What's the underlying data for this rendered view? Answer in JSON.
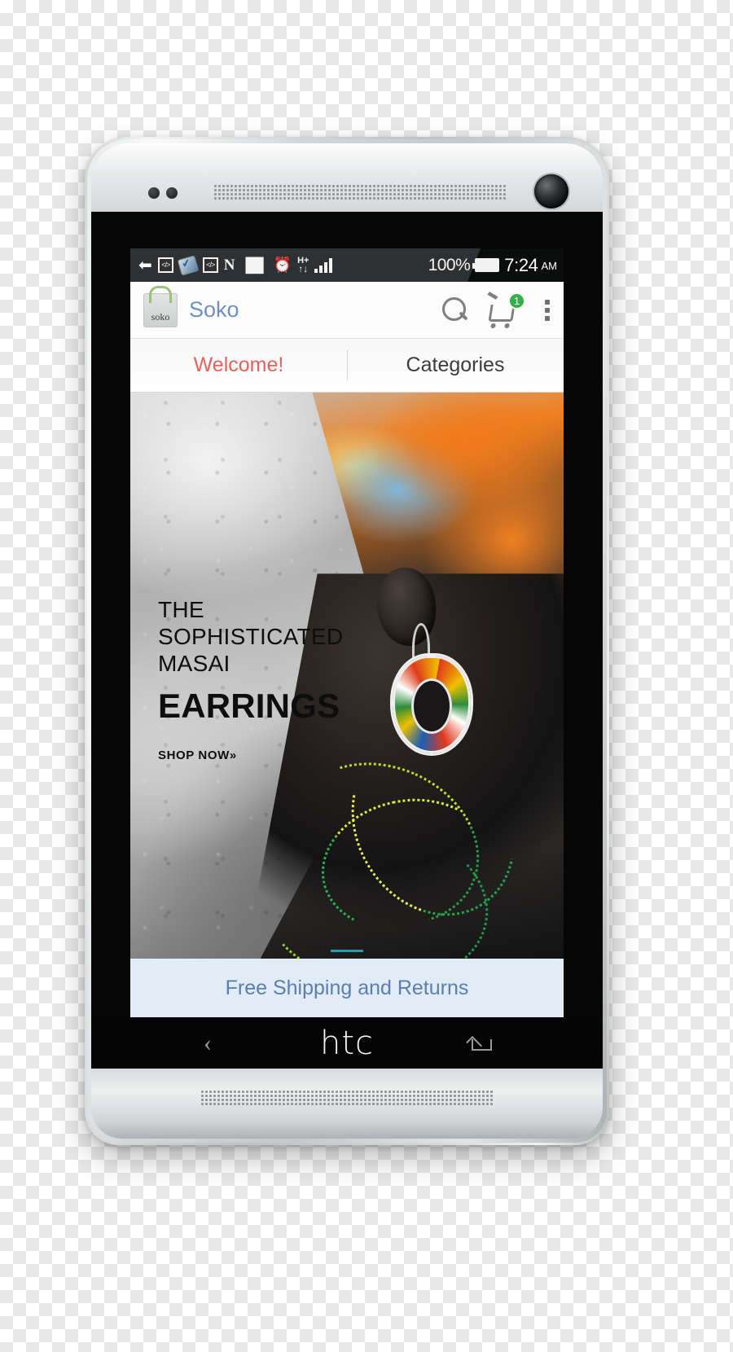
{
  "device": {
    "brand_logo": "htc",
    "nav_back_icon": "back-chevron-icon",
    "nav_home_icon": "home-icon"
  },
  "status_bar": {
    "time": "7:24",
    "am_pm": "AM",
    "battery_percent": "100%",
    "icons": [
      "arrow-plus-icon",
      "code-tag-icon",
      "battery-saver-icon",
      "code-tag-icon-2",
      "nfc-icon",
      "vibrate-icon",
      "alarm-icon",
      "hsdpa-plus-icon",
      "signal-bars-icon",
      "battery-icon"
    ],
    "code_tag_label": "</>",
    "nfc_label": "N",
    "vibrate_label": "▐█▌",
    "alarm_label": "⏰",
    "hsdpa_label": "H",
    "hsdpa_plus": "+",
    "hsdpa_arrows": "↑↓",
    "arrow_plus_label": "⬅",
    "background_color": "#2e3032"
  },
  "app_bar": {
    "logo_text": "soko",
    "title": "Soko",
    "title_color": "#6f8fc4",
    "search_icon": "search-icon",
    "cart_icon": "shopping-cart-icon",
    "cart_badge_count": "1",
    "cart_badge_color": "#34b04a",
    "overflow_icon": "overflow-menu-icon"
  },
  "tabs": [
    {
      "label": "Welcome!",
      "active": true,
      "color": "#e2625e"
    },
    {
      "label": "Categories",
      "active": false,
      "color": "#3c3c3c"
    }
  ],
  "hero": {
    "line1": "THE",
    "line2": "SOPHISTICATED",
    "line3": "MASAI",
    "headline": "EARRINGS",
    "cta": "SHOP NOW»",
    "carousel_dots": 1
  },
  "promo_bar": {
    "text": "Free Shipping and Returns",
    "background_color": "#e1ecf7",
    "text_color": "#5a7fae"
  }
}
